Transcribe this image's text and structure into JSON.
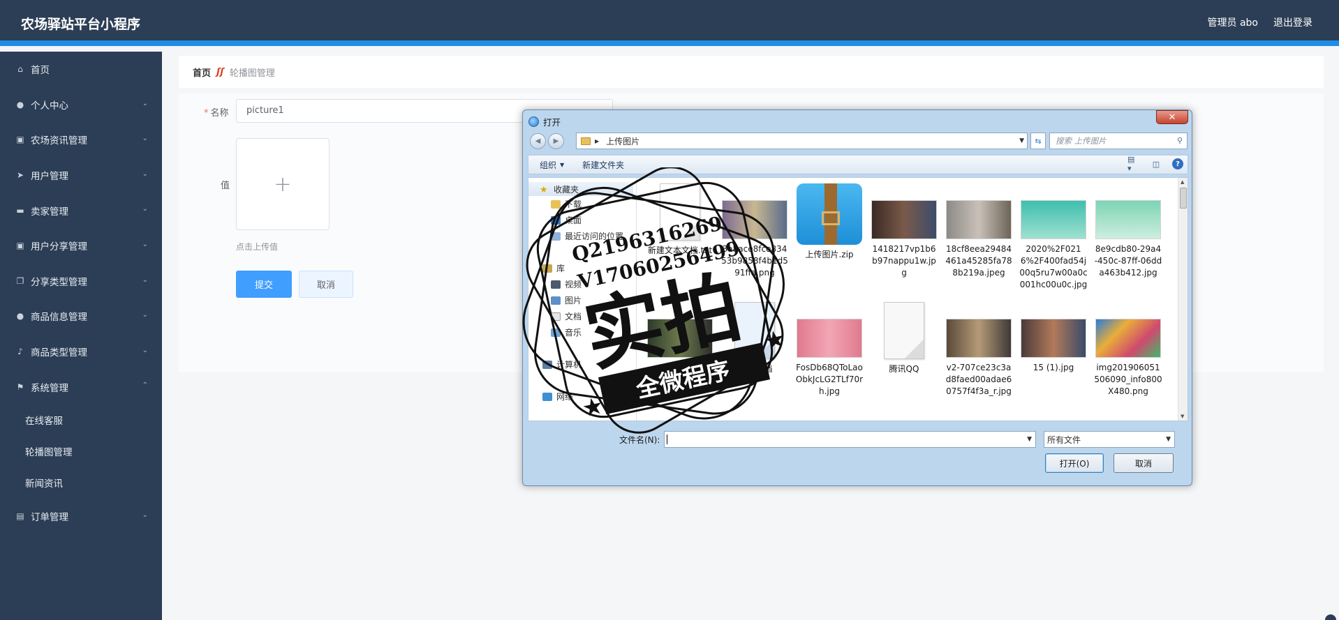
{
  "header": {
    "title": "农场驿站平台小程序",
    "user_label": "管理员 abo",
    "logout_label": "退出登录"
  },
  "sidebar": {
    "items": [
      {
        "label": "首页",
        "icon": "home-icon"
      },
      {
        "label": "个人中心",
        "icon": "user-icon"
      },
      {
        "label": "农场资讯管理",
        "icon": "clipboard-icon"
      },
      {
        "label": "用户管理",
        "icon": "send-icon"
      },
      {
        "label": "卖家管理",
        "icon": "briefcase-icon"
      },
      {
        "label": "用户分享管理",
        "icon": "clipboard-icon"
      },
      {
        "label": "分享类型管理",
        "icon": "copy-icon"
      },
      {
        "label": "商品信息管理",
        "icon": "user-icon"
      },
      {
        "label": "商品类型管理",
        "icon": "mic-icon"
      },
      {
        "label": "系统管理",
        "icon": "flag-icon"
      }
    ],
    "sub_items": [
      "在线客服",
      "轮播图管理",
      "新闻资讯"
    ],
    "last_item": {
      "label": "订单管理",
      "icon": "wallet-icon"
    }
  },
  "breadcrumb": {
    "home": "首页",
    "current": "轮播图管理"
  },
  "form": {
    "name_label": "名称",
    "name_value": "picture1",
    "value_label": "值",
    "upload_plus": "+",
    "upload_tip": "点击上传值",
    "submit_label": "提交",
    "cancel_label": "取消"
  },
  "dialog": {
    "title": "打开",
    "close": "✕",
    "address": "上传图片",
    "search_placeholder": "搜索 上传图片",
    "organize": "组织",
    "new_folder": "新建文件夹",
    "tree": [
      "收藏夹",
      "下载",
      "桌面",
      "最近访问的位置",
      "库",
      "视频",
      "图片",
      "文档",
      "音乐",
      "计算机",
      "网络"
    ],
    "files": [
      "新建文本文档.txt",
      "3a8ace8fce83453b9858f4b1d591ffa.png",
      "上传图片.zip",
      "1418217vp1b6b97nappu1w.jpg",
      "18cf8eea29484461a45285fa788b219a.jpeg",
      "2020%2F0216%2F400fad54j00q5ru7w00a0c001hc00u0c.jpg",
      "8e9cdb80-29a4-450c-87ff-06dda463b412.jpg",
      "221400",
      "DOC文档",
      "FosDb68QToLaoObkJcLG2TLf70rh.jpg",
      "腾讯QQ",
      "v2-707ce23c3ad8faed00adae60757f4f3a_r.jpg",
      "15 (1).jpg",
      "img201906051506090_info800X480.png"
    ],
    "filename_label": "文件名(N):",
    "filetype": "所有文件",
    "open_btn": "打开(O)",
    "cancel_btn": "取消"
  },
  "watermark": {
    "line1": "Q2196316269",
    "line2": "V17060256499",
    "big": "实拍",
    "ribbon": "全微程序"
  },
  "colors": {
    "sidebar_bg": "#2c3e55",
    "accent": "#1f8ce6",
    "primary_btn": "#409eff"
  }
}
